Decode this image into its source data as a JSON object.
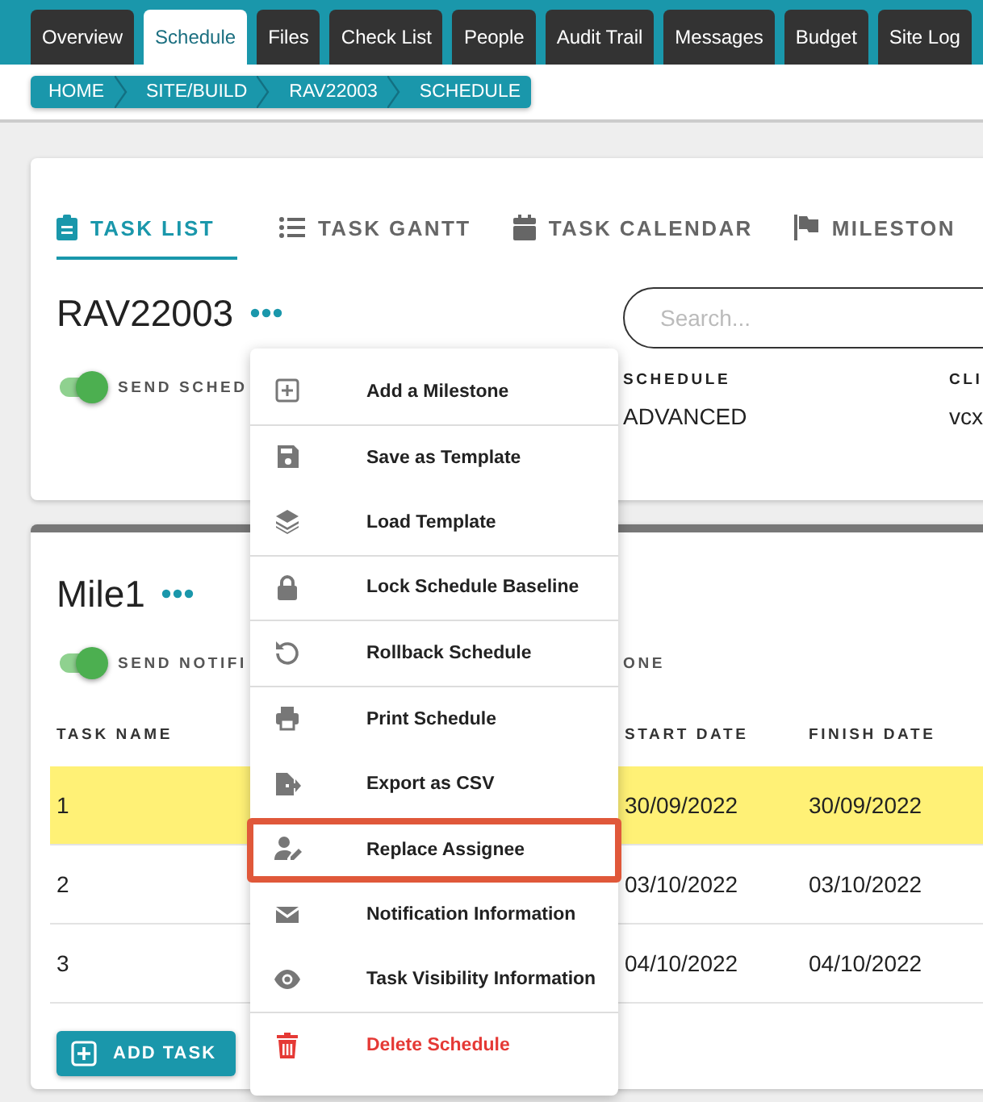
{
  "nav_tabs": [
    {
      "label": "Overview",
      "selected": false
    },
    {
      "label": "Schedule",
      "selected": true
    },
    {
      "label": "Files",
      "selected": false
    },
    {
      "label": "Check List",
      "selected": false
    },
    {
      "label": "People",
      "selected": false
    },
    {
      "label": "Audit Trail",
      "selected": false
    },
    {
      "label": "Messages",
      "selected": false
    },
    {
      "label": "Budget",
      "selected": false
    },
    {
      "label": "Site Log",
      "selected": false
    }
  ],
  "breadcrumb": [
    "HOME",
    "SITE/BUILD",
    "RAV22003",
    "SCHEDULE"
  ],
  "view_tabs": [
    {
      "label": "TASK LIST",
      "kind": "list",
      "selected": true
    },
    {
      "label": "TASK GANTT",
      "kind": "gantt",
      "selected": false
    },
    {
      "label": "TASK CALENDAR",
      "kind": "calendar",
      "selected": false
    },
    {
      "label": "MILESTON",
      "kind": "milestone",
      "selected": false
    }
  ],
  "schedule": {
    "title": "RAV22003",
    "search": {
      "placeholder": "Search..."
    },
    "toggle": {
      "label": "SEND SCHED",
      "on": true
    },
    "info": [
      {
        "label": "SCHEDULE",
        "value": "ADVANCED"
      },
      {
        "label": "CLI",
        "value": "vcx"
      }
    ]
  },
  "milestone": {
    "title": "Mile1",
    "toggle": {
      "label": "SEND NOTIFI",
      "on": true
    },
    "column_label": "ONE",
    "table": {
      "columns": [
        "TASK NAME",
        "START DATE",
        "FINISH DATE"
      ],
      "rows": [
        {
          "cells": [
            "1",
            "30/09/2022",
            "30/09/2022"
          ],
          "highlighted": true
        },
        {
          "cells": [
            "2",
            "03/10/2022",
            "03/10/2022"
          ],
          "highlighted": false
        },
        {
          "cells": [
            "3",
            "04/10/2022",
            "04/10/2022"
          ],
          "highlighted": false
        }
      ]
    },
    "add_button": "ADD TASK"
  },
  "menu": {
    "items": [
      {
        "label": "Add a Milestone",
        "kind": "add",
        "divider": true,
        "highlighted": false
      },
      {
        "label": "Save as Template",
        "kind": "save",
        "divider": false,
        "highlighted": false
      },
      {
        "label": "Load Template",
        "kind": "layers",
        "divider": true,
        "highlighted": false
      },
      {
        "label": "Lock Schedule Baseline",
        "kind": "lock",
        "divider": true,
        "highlighted": false
      },
      {
        "label": "Rollback Schedule",
        "kind": "rollback",
        "divider": true,
        "highlighted": false
      },
      {
        "label": "Print Schedule",
        "kind": "print",
        "divider": false,
        "highlighted": false
      },
      {
        "label": "Export as CSV",
        "kind": "export",
        "divider": false,
        "highlighted": false
      },
      {
        "label": "Replace Assignee",
        "kind": "assignee",
        "divider": false,
        "highlighted": true
      },
      {
        "label": "Notification Information",
        "kind": "mail",
        "divider": false,
        "highlighted": false
      },
      {
        "label": "Task Visibility Information",
        "kind": "eye",
        "divider": true,
        "highlighted": false
      },
      {
        "label": "Delete Schedule",
        "kind": "delete",
        "divider": false,
        "highlighted": false
      }
    ]
  }
}
